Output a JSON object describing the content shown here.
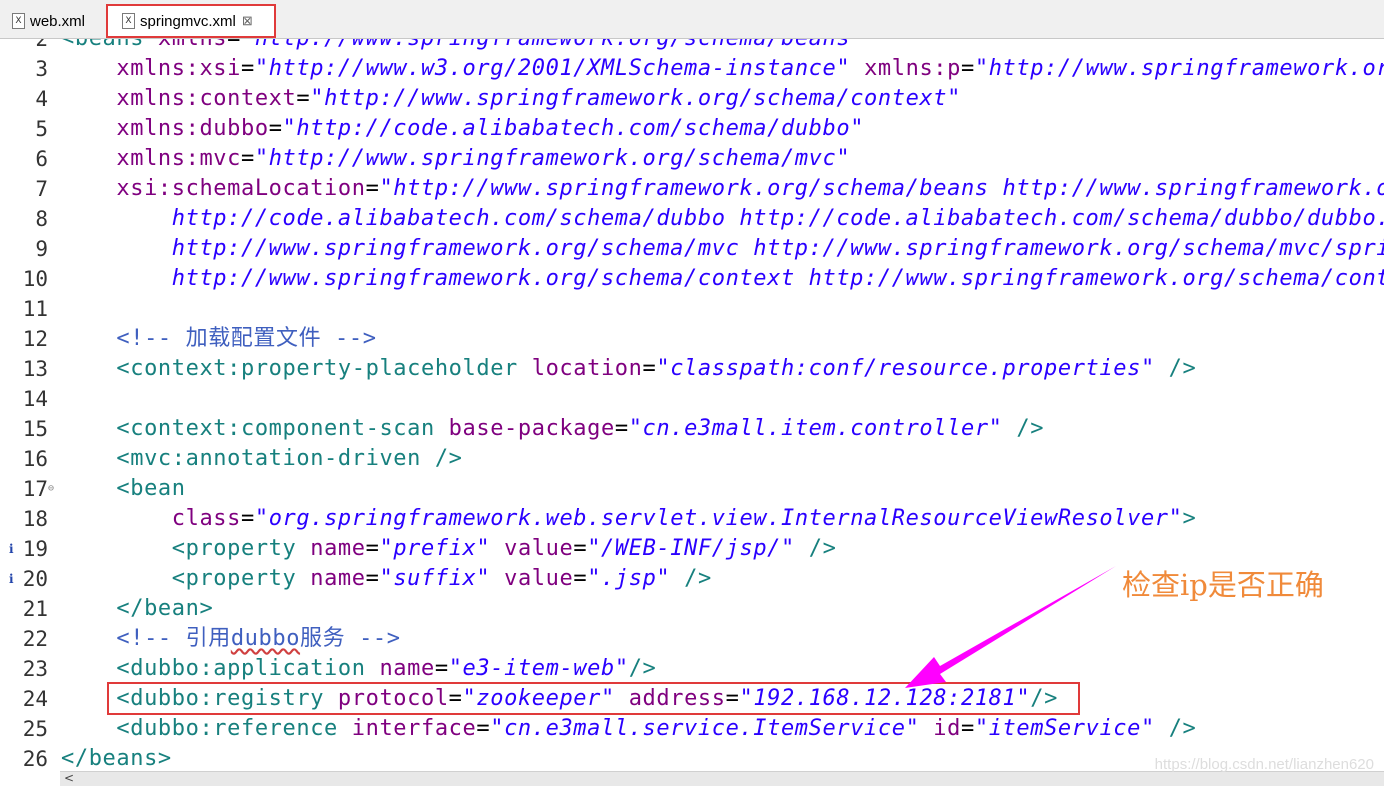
{
  "tabs": [
    {
      "label": "web.xml",
      "icon": "xml-file-icon",
      "active": false
    },
    {
      "label": "springmvc.xml",
      "icon": "xml-file-icon",
      "active": true,
      "close": "⊠"
    }
  ],
  "colors": {
    "tag": "#17807e",
    "attr": "#7f007f",
    "value": "#2a00ff",
    "comment": "#3f5fbf",
    "highlight": "#e03a3a",
    "annotation": "#f08a3a",
    "arrow": "#ff00ff"
  },
  "lines": [
    {
      "n": "2",
      "segs": [
        [
          "tag",
          "<beans "
        ],
        [
          "attr",
          "xmlns"
        ],
        [
          "eq",
          "="
        ],
        [
          "val",
          "\"http://www.springframework.org/schema/beans\""
        ]
      ]
    },
    {
      "n": "3",
      "segs": [
        [
          "attr",
          "    xmlns:xsi"
        ],
        [
          "eq",
          "="
        ],
        [
          "val",
          "\"http://www.w3.org/2001/XMLSchema-instance\""
        ],
        [
          "eq",
          " "
        ],
        [
          "attr",
          "xmlns:p"
        ],
        [
          "eq",
          "="
        ],
        [
          "val",
          "\"http://www.springframework.org/schema/p\""
        ]
      ]
    },
    {
      "n": "4",
      "segs": [
        [
          "attr",
          "    xmlns:context"
        ],
        [
          "eq",
          "="
        ],
        [
          "val",
          "\"http://www.springframework.org/schema/context\""
        ]
      ]
    },
    {
      "n": "5",
      "segs": [
        [
          "attr",
          "    xmlns:dubbo"
        ],
        [
          "eq",
          "="
        ],
        [
          "val",
          "\"http://code.alibabatech.com/schema/dubbo\""
        ]
      ]
    },
    {
      "n": "6",
      "segs": [
        [
          "attr",
          "    xmlns:mvc"
        ],
        [
          "eq",
          "="
        ],
        [
          "val",
          "\"http://www.springframework.org/schema/mvc\""
        ]
      ]
    },
    {
      "n": "7",
      "segs": [
        [
          "attr",
          "    xsi:schemaLocation"
        ],
        [
          "eq",
          "="
        ],
        [
          "val",
          "\"http://www.springframework.org/schema/beans http://www.springframework.org/schema/beans/spring-beans.xsd"
        ]
      ]
    },
    {
      "n": "8",
      "segs": [
        [
          "val",
          "        http://code.alibabatech.com/schema/dubbo http://code.alibabatech.com/schema/dubbo/dubbo.xsd"
        ]
      ]
    },
    {
      "n": "9",
      "segs": [
        [
          "val",
          "        http://www.springframework.org/schema/mvc http://www.springframework.org/schema/mvc/spring-mvc.xsd"
        ]
      ]
    },
    {
      "n": "10",
      "segs": [
        [
          "val",
          "        http://www.springframework.org/schema/context http://www.springframework.org/schema/context/spring-context.xsd\">"
        ]
      ]
    },
    {
      "n": "11",
      "segs": []
    },
    {
      "n": "12",
      "segs": [
        [
          "cmt",
          "    <!-- 加载配置文件 -->"
        ]
      ]
    },
    {
      "n": "13",
      "segs": [
        [
          "tag",
          "    <context:property-placeholder "
        ],
        [
          "attr",
          "location"
        ],
        [
          "eq",
          "="
        ],
        [
          "val",
          "\"classpath:conf/resource.properties\""
        ],
        [
          "tag",
          " />"
        ]
      ]
    },
    {
      "n": "14",
      "segs": []
    },
    {
      "n": "15",
      "segs": [
        [
          "tag",
          "    <context:component-scan "
        ],
        [
          "attr",
          "base-package"
        ],
        [
          "eq",
          "="
        ],
        [
          "val",
          "\"cn.e3mall.item.controller\""
        ],
        [
          "tag",
          " />"
        ]
      ]
    },
    {
      "n": "16",
      "segs": [
        [
          "tag",
          "    <mvc:annotation-driven />"
        ]
      ]
    },
    {
      "n": "17",
      "segs": [
        [
          "tag",
          "    <bean"
        ]
      ],
      "fold": true
    },
    {
      "n": "18",
      "segs": [
        [
          "attr",
          "        class"
        ],
        [
          "eq",
          "="
        ],
        [
          "val",
          "\"org.springframework.web.servlet.view.InternalResourceViewResolver\""
        ],
        [
          "tag",
          ">"
        ]
      ]
    },
    {
      "n": "19",
      "segs": [
        [
          "tag",
          "        <property "
        ],
        [
          "attr",
          "name"
        ],
        [
          "eq",
          "="
        ],
        [
          "val",
          "\"prefix\""
        ],
        [
          "eq",
          " "
        ],
        [
          "attr",
          "value"
        ],
        [
          "eq",
          "="
        ],
        [
          "val",
          "\"/WEB-INF/jsp/\""
        ],
        [
          "tag",
          " />"
        ]
      ],
      "info": true
    },
    {
      "n": "20",
      "segs": [
        [
          "tag",
          "        <property "
        ],
        [
          "attr",
          "name"
        ],
        [
          "eq",
          "="
        ],
        [
          "val",
          "\"suffix\""
        ],
        [
          "eq",
          " "
        ],
        [
          "attr",
          "value"
        ],
        [
          "eq",
          "="
        ],
        [
          "val",
          "\".jsp\""
        ],
        [
          "tag",
          " />"
        ]
      ],
      "info": true
    },
    {
      "n": "21",
      "segs": [
        [
          "tag",
          "    </bean>"
        ]
      ]
    },
    {
      "n": "22",
      "segs": [
        [
          "cmt",
          "    <!-- 引用"
        ],
        [
          "cmtsq",
          "dubbo"
        ],
        [
          "cmt",
          "服务 -->"
        ]
      ]
    },
    {
      "n": "23",
      "segs": [
        [
          "tag",
          "    <dubbo:application "
        ],
        [
          "attr",
          "name"
        ],
        [
          "eq",
          "="
        ],
        [
          "val",
          "\"e3-item-web\""
        ],
        [
          "tag",
          "/>"
        ]
      ]
    },
    {
      "n": "24",
      "segs": [
        [
          "tag",
          "    <dubbo:registry "
        ],
        [
          "attr",
          "protocol"
        ],
        [
          "eq",
          "="
        ],
        [
          "val",
          "\"zookeeper\""
        ],
        [
          "eq",
          " "
        ],
        [
          "attr",
          "address"
        ],
        [
          "eq",
          "="
        ],
        [
          "val",
          "\"192.168.12.128:2181\""
        ],
        [
          "tag",
          "/>"
        ]
      ]
    },
    {
      "n": "25",
      "segs": [
        [
          "tag",
          "    <dubbo:reference "
        ],
        [
          "attr",
          "interface"
        ],
        [
          "eq",
          "="
        ],
        [
          "val",
          "\"cn.e3mall.service.ItemService\""
        ],
        [
          "eq",
          " "
        ],
        [
          "attr",
          "id"
        ],
        [
          "eq",
          "="
        ],
        [
          "val",
          "\"itemService\""
        ],
        [
          "tag",
          " />"
        ]
      ]
    },
    {
      "n": "26",
      "segs": [
        [
          "tag",
          "</beans>"
        ]
      ]
    }
  ],
  "annotation": {
    "text": "检查ip是否正确"
  },
  "info_marker": "i",
  "fold_marker": "⊖",
  "scroll_left": "<",
  "watermark": "https://blog.csdn.net/lianzhen620"
}
